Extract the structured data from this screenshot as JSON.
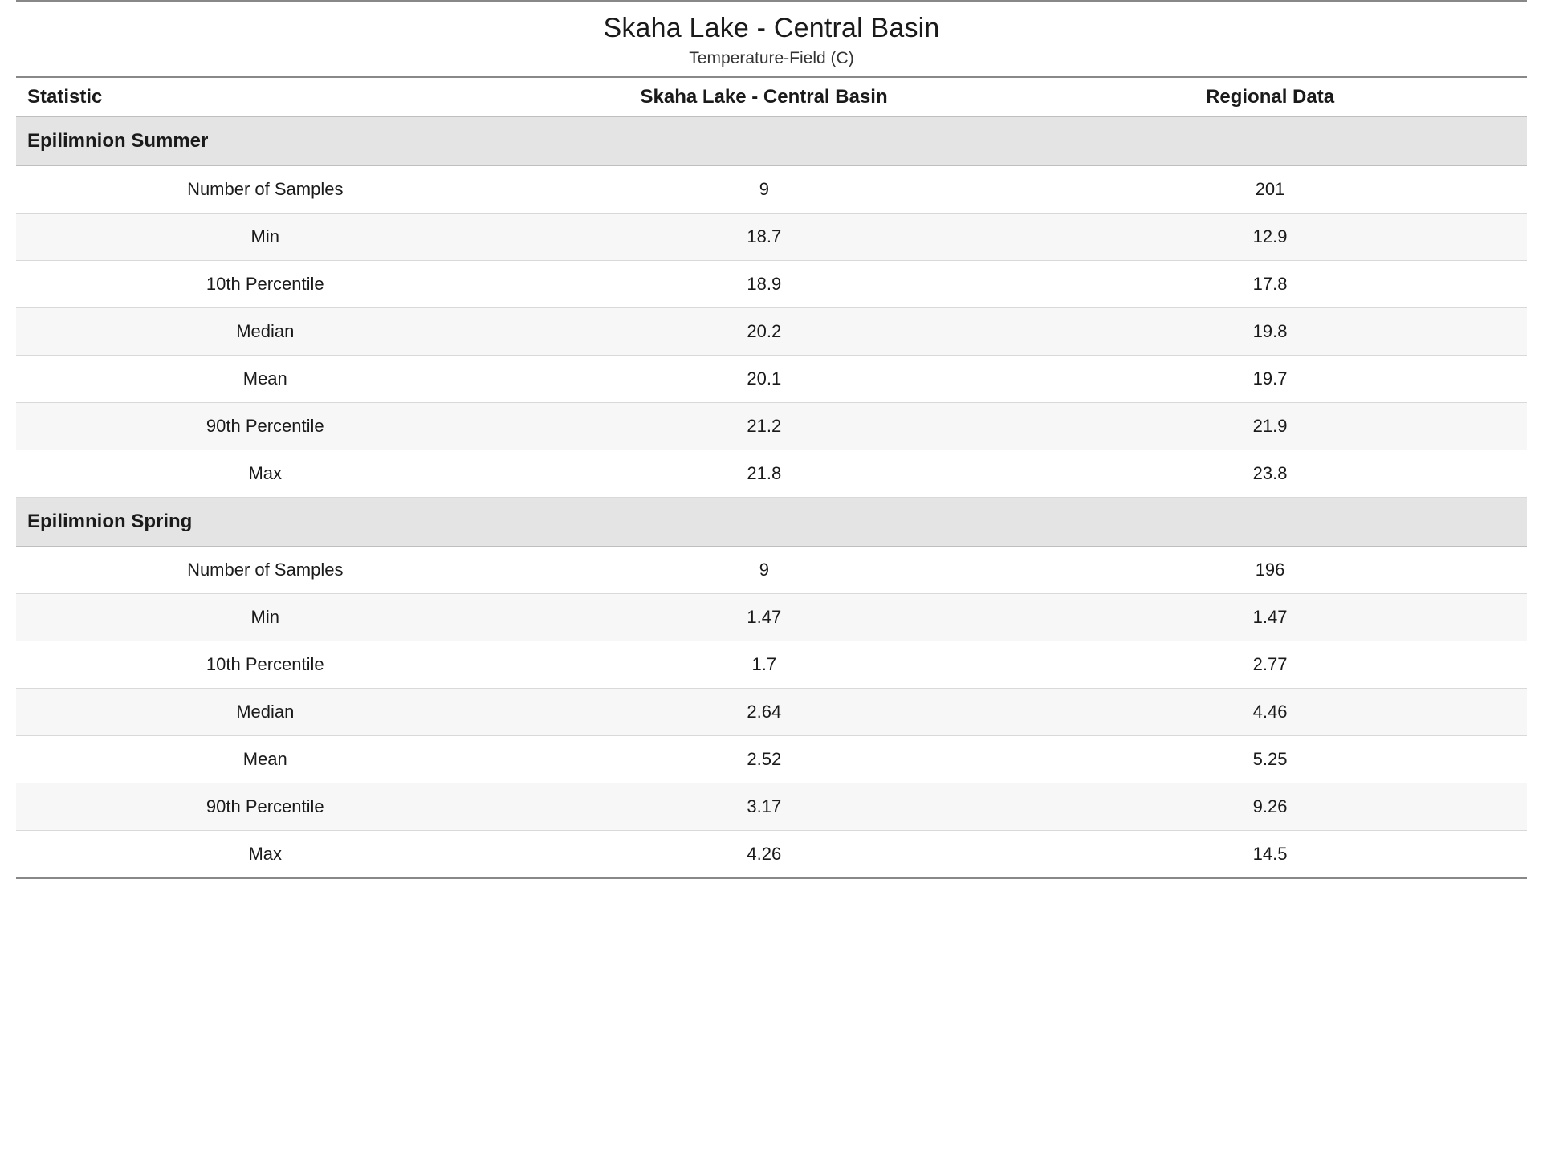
{
  "title": "Skaha Lake - Central Basin",
  "subtitle": "Temperature-Field (C)",
  "columns": {
    "statistic": "Statistic",
    "site": "Skaha Lake - Central Basin",
    "region": "Regional Data"
  },
  "sections": [
    {
      "name": "Epilimnion Summer",
      "rows": [
        {
          "stat": "Number of Samples",
          "site": "9",
          "region": "201"
        },
        {
          "stat": "Min",
          "site": "18.7",
          "region": "12.9"
        },
        {
          "stat": "10th Percentile",
          "site": "18.9",
          "region": "17.8"
        },
        {
          "stat": "Median",
          "site": "20.2",
          "region": "19.8"
        },
        {
          "stat": "Mean",
          "site": "20.1",
          "region": "19.7"
        },
        {
          "stat": "90th Percentile",
          "site": "21.2",
          "region": "21.9"
        },
        {
          "stat": "Max",
          "site": "21.8",
          "region": "23.8"
        }
      ]
    },
    {
      "name": "Epilimnion Spring",
      "rows": [
        {
          "stat": "Number of Samples",
          "site": "9",
          "region": "196"
        },
        {
          "stat": "Min",
          "site": "1.47",
          "region": "1.47"
        },
        {
          "stat": "10th Percentile",
          "site": "1.7",
          "region": "2.77"
        },
        {
          "stat": "Median",
          "site": "2.64",
          "region": "4.46"
        },
        {
          "stat": "Mean",
          "site": "2.52",
          "region": "5.25"
        },
        {
          "stat": "90th Percentile",
          "site": "3.17",
          "region": "9.26"
        },
        {
          "stat": "Max",
          "site": "4.26",
          "region": "14.5"
        }
      ]
    }
  ]
}
